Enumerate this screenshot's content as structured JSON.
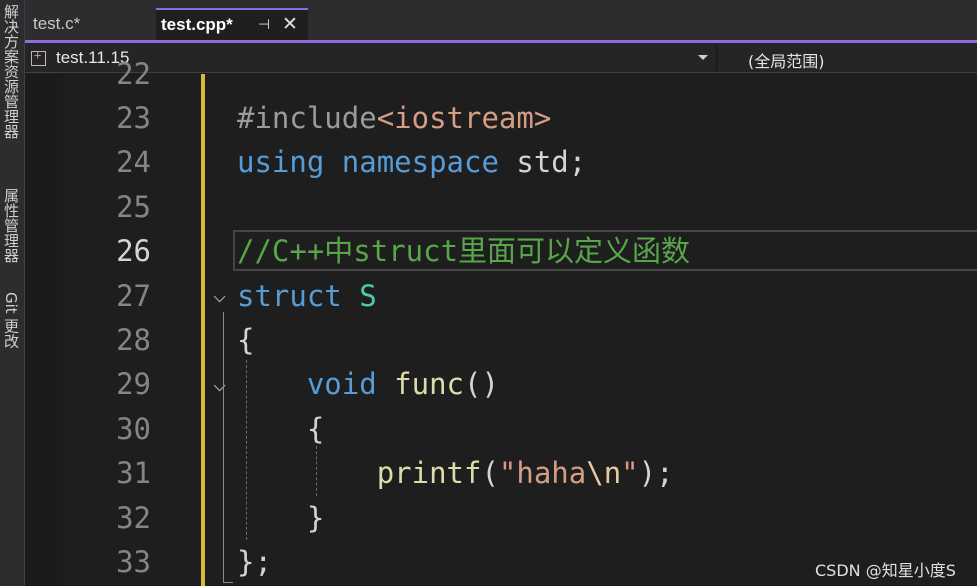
{
  "side_panel": {
    "tabs": [
      "解决方案资源管理器",
      "属性管理器",
      "Git 更改"
    ]
  },
  "tabs": [
    {
      "label": "test.c*",
      "active": false
    },
    {
      "label": "test.cpp*",
      "active": true
    }
  ],
  "tab_icons": {
    "pin": "pin-icon",
    "close": "close-icon"
  },
  "nav": {
    "project": "test.11.15",
    "scope": "(全局范围)"
  },
  "editor": {
    "top_partial_line": "22",
    "current_line": "26",
    "lines": [
      {
        "num": "23",
        "tokens": [
          [
            "#include",
            "dir"
          ],
          [
            "<iostream>",
            "inc"
          ]
        ]
      },
      {
        "num": "24",
        "tokens": [
          [
            "using",
            "kw"
          ],
          [
            " ",
            ""
          ],
          [
            "namespace",
            "kw"
          ],
          [
            " std;",
            ""
          ]
        ]
      },
      {
        "num": "25",
        "tokens": []
      },
      {
        "num": "26",
        "tokens": [
          [
            "//C++中struct里面可以定义函数",
            "com"
          ]
        ]
      },
      {
        "num": "27",
        "tokens": [
          [
            "struct",
            "kw"
          ],
          [
            " ",
            ""
          ],
          [
            "S",
            "type"
          ]
        ]
      },
      {
        "num": "28",
        "tokens": [
          [
            "{",
            ""
          ]
        ]
      },
      {
        "num": "29",
        "tokens": [
          [
            "    ",
            ""
          ],
          [
            "void",
            "kw"
          ],
          [
            " ",
            ""
          ],
          [
            "func",
            "fn"
          ],
          [
            "()",
            ""
          ]
        ]
      },
      {
        "num": "30",
        "tokens": [
          [
            "    {",
            ""
          ]
        ]
      },
      {
        "num": "31",
        "tokens": [
          [
            "        ",
            ""
          ],
          [
            "printf",
            "fn"
          ],
          [
            "(",
            ""
          ],
          [
            "\"haha",
            "str"
          ],
          [
            "\\n",
            "esc"
          ],
          [
            "\"",
            "str"
          ],
          [
            ");",
            ""
          ]
        ]
      },
      {
        "num": "32",
        "tokens": [
          [
            "    }",
            ""
          ]
        ]
      },
      {
        "num": "33",
        "tokens": [
          [
            "};",
            ""
          ]
        ]
      }
    ]
  },
  "colors": {
    "accent": "#8f6cdc",
    "keyword": "#569cd6",
    "type": "#4ec9b0",
    "function": "#dcdcaa",
    "string": "#d69d85",
    "comment": "#57a64a",
    "change_bar": "#d7ba3d"
  },
  "watermark": "CSDN @知星小度S"
}
